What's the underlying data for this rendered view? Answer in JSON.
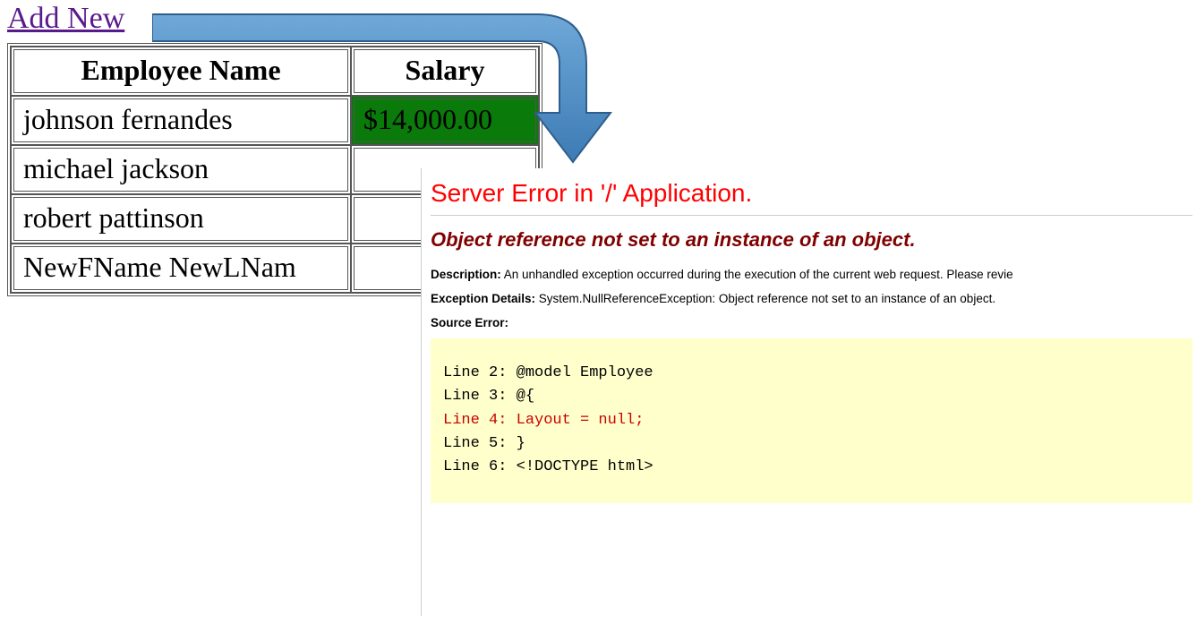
{
  "link": {
    "add_new": "Add New"
  },
  "table": {
    "headers": {
      "name": "Employee Name",
      "salary": "Salary"
    },
    "rows": [
      {
        "name": "johnson fernandes",
        "salary": "$14,000.00",
        "highlight": true
      },
      {
        "name": "michael jackson",
        "salary": ""
      },
      {
        "name": "robert pattinson",
        "salary": ""
      },
      {
        "name": "NewFName NewLNam",
        "salary": ""
      }
    ]
  },
  "error": {
    "title": "Server Error in '/' Application.",
    "subtitle": "Object reference not set to an instance of an object.",
    "desc_label": "Description:",
    "desc_text": "An unhandled exception occurred during the execution of the current web request. Please revie",
    "exc_label": "Exception Details:",
    "exc_text": "System.NullReferenceException: Object reference not set to an instance of an object.",
    "src_label": "Source Error:",
    "code": {
      "l2": "Line 2:  @model Employee",
      "l3": "Line 3:  @{",
      "l4": "Line 4:      Layout = null;",
      "l5": "Line 5:  }",
      "l6": "Line 6:  <!DOCTYPE html>"
    }
  }
}
